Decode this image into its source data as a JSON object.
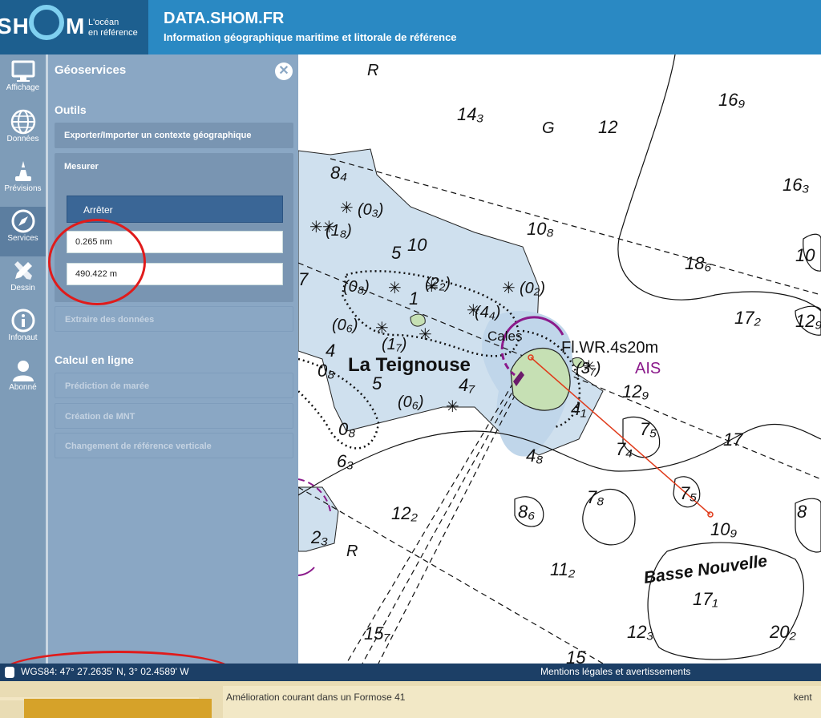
{
  "header": {
    "logo_left": "SH",
    "logo_right": "M",
    "logo_tag_1": "L'océan",
    "logo_tag_2": "en référence",
    "title": "DATA.SHOM.FR",
    "subtitle": "Information géographique maritime et littorale de référence"
  },
  "iconbar": {
    "items": [
      {
        "label": "Affichage",
        "icon": "monitor-icon"
      },
      {
        "label": "Données",
        "icon": "globe-icon"
      },
      {
        "label": "Prévisions",
        "icon": "buoy-icon"
      },
      {
        "label": "Services",
        "icon": "compass-icon"
      },
      {
        "label": "Dessin",
        "icon": "pencil-icon"
      },
      {
        "label": "Infonaut",
        "icon": "info-icon"
      },
      {
        "label": "Abonné",
        "icon": "user-icon"
      }
    ]
  },
  "panel": {
    "title": "Géoservices",
    "close": "✕",
    "outils": "Outils",
    "export_label": "Exporter/Importer un contexte géographique",
    "mesurer_label": "Mesurer",
    "stop_label": "Arrêter",
    "distance_nm": "0.265 nm",
    "distance_m": "490.422 m",
    "extract_label": "Extraire des données",
    "calcul": "Calcul en ligne",
    "tide_label": "Prédiction de marée",
    "mnt_label": "Création de MNT",
    "ref_label": "Changement de référence verticale"
  },
  "map": {
    "place_name": "La Teignouse",
    "shoal_name": "Basse Nouvelle",
    "light_label": "Fl.WR.4s20m",
    "ais_label": "AIS",
    "cales_label": "Cales",
    "letters": [
      "R",
      "G",
      "R"
    ]
  },
  "status": {
    "coords": "WGS84: 47° 27.2635' N, 3° 02.4589' W",
    "legal": "Mentions légales et avertissements"
  },
  "bottom": {
    "text": "Amélioration courant dans un Formose 41",
    "right": "kent"
  },
  "colors": {
    "header": "#2a89c3",
    "panel": "#8aa7c4",
    "statusbar": "#1c3f66",
    "annotation": "#e01b1b"
  }
}
